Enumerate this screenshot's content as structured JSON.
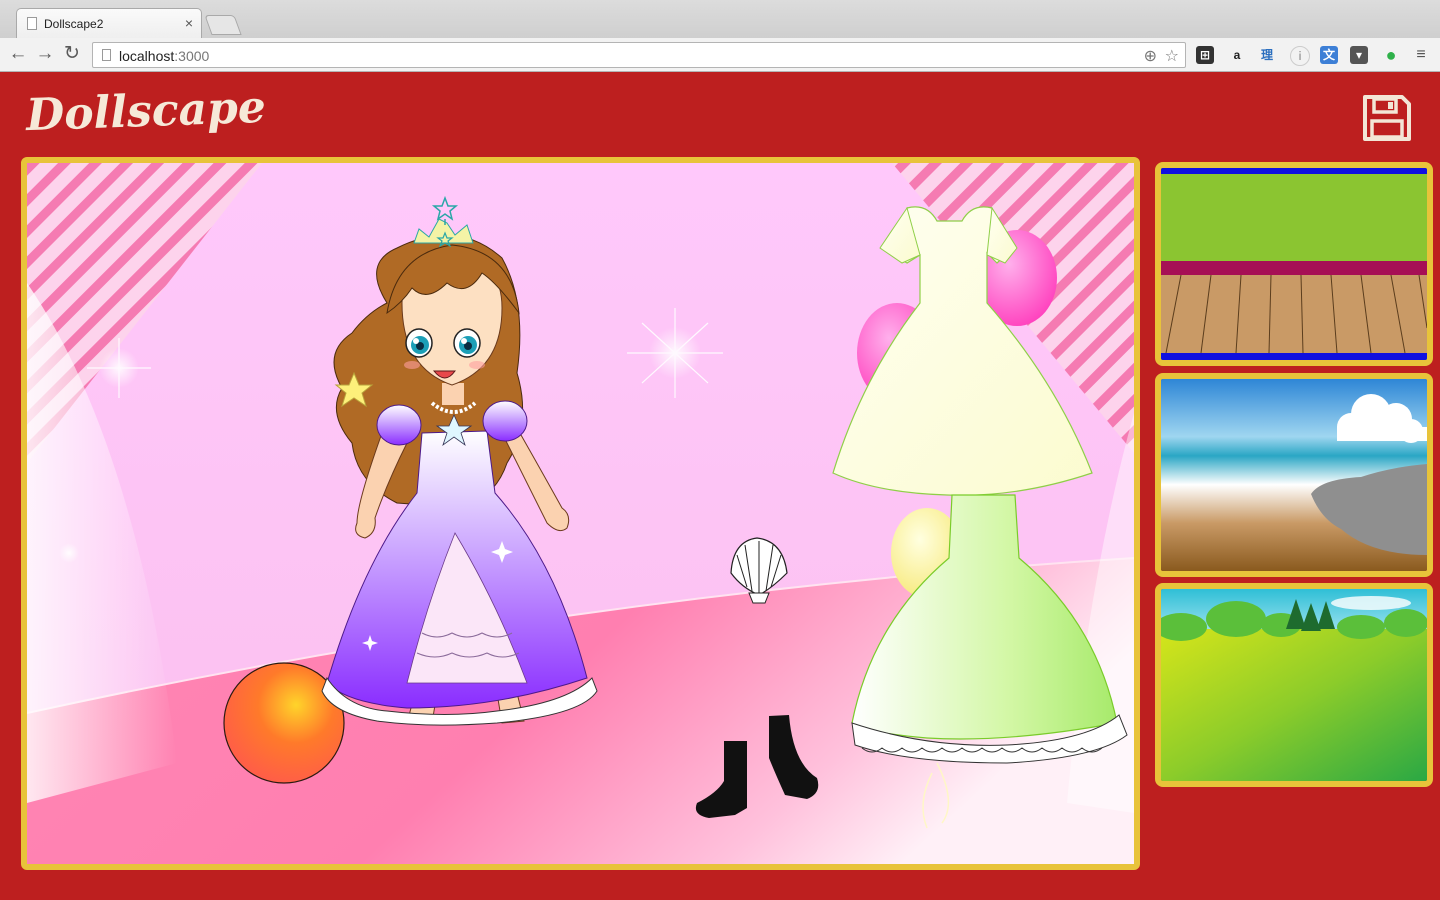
{
  "browser": {
    "tab_title": "Dollscape2",
    "tab_close": "×",
    "url_host": "localhost",
    "url_port": ":3000"
  },
  "app": {
    "title": "Dollscape",
    "save_icon": "floppy-disk-icon"
  },
  "colors": {
    "page_bg": "#bd1f1f",
    "frame": "#e8c33a",
    "title": "#f6e9d8"
  },
  "stage": {
    "background": "pink-party-room",
    "items": [
      "princess-doll",
      "crown",
      "ball",
      "white-dress",
      "green-dress",
      "seashell",
      "black-boots"
    ]
  },
  "backgrounds": [
    {
      "name": "stage-floor"
    },
    {
      "name": "seaside-cliff"
    },
    {
      "name": "green-meadow"
    }
  ]
}
